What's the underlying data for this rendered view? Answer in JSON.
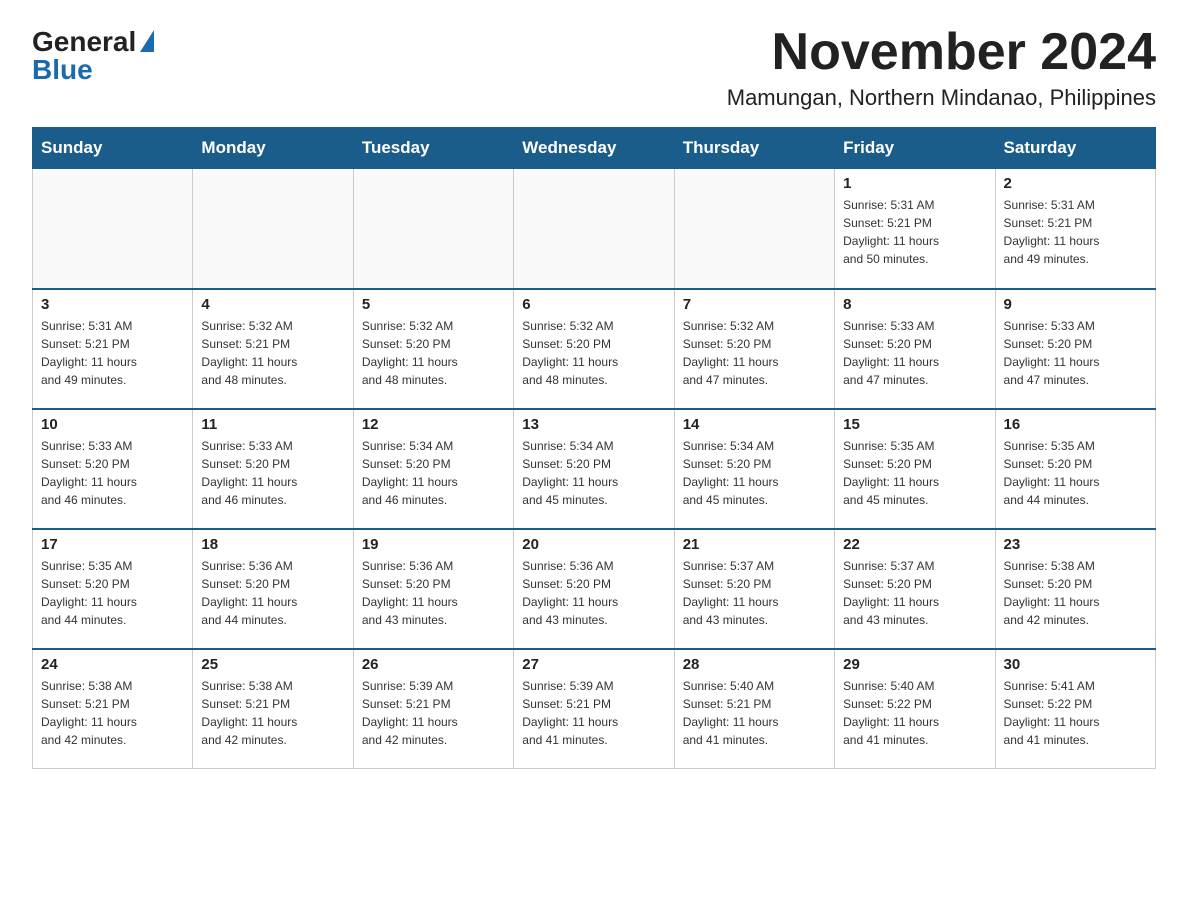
{
  "logo": {
    "general": "General",
    "blue": "Blue"
  },
  "header": {
    "month": "November 2024",
    "location": "Mamungan, Northern Mindanao, Philippines"
  },
  "days_header": [
    "Sunday",
    "Monday",
    "Tuesday",
    "Wednesday",
    "Thursday",
    "Friday",
    "Saturday"
  ],
  "weeks": [
    [
      {
        "day": "",
        "info": ""
      },
      {
        "day": "",
        "info": ""
      },
      {
        "day": "",
        "info": ""
      },
      {
        "day": "",
        "info": ""
      },
      {
        "day": "",
        "info": ""
      },
      {
        "day": "1",
        "info": "Sunrise: 5:31 AM\nSunset: 5:21 PM\nDaylight: 11 hours\nand 50 minutes."
      },
      {
        "day": "2",
        "info": "Sunrise: 5:31 AM\nSunset: 5:21 PM\nDaylight: 11 hours\nand 49 minutes."
      }
    ],
    [
      {
        "day": "3",
        "info": "Sunrise: 5:31 AM\nSunset: 5:21 PM\nDaylight: 11 hours\nand 49 minutes."
      },
      {
        "day": "4",
        "info": "Sunrise: 5:32 AM\nSunset: 5:21 PM\nDaylight: 11 hours\nand 48 minutes."
      },
      {
        "day": "5",
        "info": "Sunrise: 5:32 AM\nSunset: 5:20 PM\nDaylight: 11 hours\nand 48 minutes."
      },
      {
        "day": "6",
        "info": "Sunrise: 5:32 AM\nSunset: 5:20 PM\nDaylight: 11 hours\nand 48 minutes."
      },
      {
        "day": "7",
        "info": "Sunrise: 5:32 AM\nSunset: 5:20 PM\nDaylight: 11 hours\nand 47 minutes."
      },
      {
        "day": "8",
        "info": "Sunrise: 5:33 AM\nSunset: 5:20 PM\nDaylight: 11 hours\nand 47 minutes."
      },
      {
        "day": "9",
        "info": "Sunrise: 5:33 AM\nSunset: 5:20 PM\nDaylight: 11 hours\nand 47 minutes."
      }
    ],
    [
      {
        "day": "10",
        "info": "Sunrise: 5:33 AM\nSunset: 5:20 PM\nDaylight: 11 hours\nand 46 minutes."
      },
      {
        "day": "11",
        "info": "Sunrise: 5:33 AM\nSunset: 5:20 PM\nDaylight: 11 hours\nand 46 minutes."
      },
      {
        "day": "12",
        "info": "Sunrise: 5:34 AM\nSunset: 5:20 PM\nDaylight: 11 hours\nand 46 minutes."
      },
      {
        "day": "13",
        "info": "Sunrise: 5:34 AM\nSunset: 5:20 PM\nDaylight: 11 hours\nand 45 minutes."
      },
      {
        "day": "14",
        "info": "Sunrise: 5:34 AM\nSunset: 5:20 PM\nDaylight: 11 hours\nand 45 minutes."
      },
      {
        "day": "15",
        "info": "Sunrise: 5:35 AM\nSunset: 5:20 PM\nDaylight: 11 hours\nand 45 minutes."
      },
      {
        "day": "16",
        "info": "Sunrise: 5:35 AM\nSunset: 5:20 PM\nDaylight: 11 hours\nand 44 minutes."
      }
    ],
    [
      {
        "day": "17",
        "info": "Sunrise: 5:35 AM\nSunset: 5:20 PM\nDaylight: 11 hours\nand 44 minutes."
      },
      {
        "day": "18",
        "info": "Sunrise: 5:36 AM\nSunset: 5:20 PM\nDaylight: 11 hours\nand 44 minutes."
      },
      {
        "day": "19",
        "info": "Sunrise: 5:36 AM\nSunset: 5:20 PM\nDaylight: 11 hours\nand 43 minutes."
      },
      {
        "day": "20",
        "info": "Sunrise: 5:36 AM\nSunset: 5:20 PM\nDaylight: 11 hours\nand 43 minutes."
      },
      {
        "day": "21",
        "info": "Sunrise: 5:37 AM\nSunset: 5:20 PM\nDaylight: 11 hours\nand 43 minutes."
      },
      {
        "day": "22",
        "info": "Sunrise: 5:37 AM\nSunset: 5:20 PM\nDaylight: 11 hours\nand 43 minutes."
      },
      {
        "day": "23",
        "info": "Sunrise: 5:38 AM\nSunset: 5:20 PM\nDaylight: 11 hours\nand 42 minutes."
      }
    ],
    [
      {
        "day": "24",
        "info": "Sunrise: 5:38 AM\nSunset: 5:21 PM\nDaylight: 11 hours\nand 42 minutes."
      },
      {
        "day": "25",
        "info": "Sunrise: 5:38 AM\nSunset: 5:21 PM\nDaylight: 11 hours\nand 42 minutes."
      },
      {
        "day": "26",
        "info": "Sunrise: 5:39 AM\nSunset: 5:21 PM\nDaylight: 11 hours\nand 42 minutes."
      },
      {
        "day": "27",
        "info": "Sunrise: 5:39 AM\nSunset: 5:21 PM\nDaylight: 11 hours\nand 41 minutes."
      },
      {
        "day": "28",
        "info": "Sunrise: 5:40 AM\nSunset: 5:21 PM\nDaylight: 11 hours\nand 41 minutes."
      },
      {
        "day": "29",
        "info": "Sunrise: 5:40 AM\nSunset: 5:22 PM\nDaylight: 11 hours\nand 41 minutes."
      },
      {
        "day": "30",
        "info": "Sunrise: 5:41 AM\nSunset: 5:22 PM\nDaylight: 11 hours\nand 41 minutes."
      }
    ]
  ]
}
